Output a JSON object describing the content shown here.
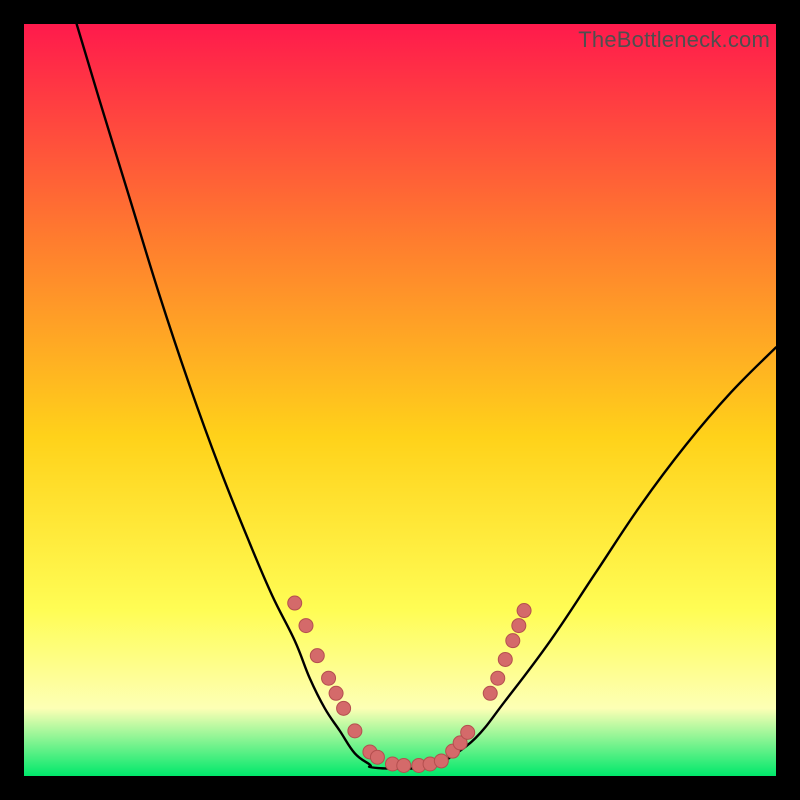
{
  "watermark": "TheBottleneck.com",
  "colors": {
    "gradient_top": "#ff1a4c",
    "gradient_mid_upper": "#ff7a2f",
    "gradient_mid": "#ffd21a",
    "gradient_mid_lower": "#fffd55",
    "gradient_pale": "#fdffb5",
    "gradient_bottom": "#00e86b",
    "curve": "#000000",
    "marker_fill": "#d46a6a",
    "marker_stroke": "#b44f4f"
  },
  "chart_data": {
    "type": "line",
    "title": "",
    "xlabel": "",
    "ylabel": "",
    "xlim": [
      0,
      100
    ],
    "ylim": [
      0,
      100
    ],
    "note": "Axes are implicit (no tick labels shown). x≈relative horizontal position (0–100), y≈bottleneck/mismatch percentage where 0 is bottom (green, good match) and 100 is top (red, severe bottleneck). Values are estimated from pixel positions.",
    "series": [
      {
        "name": "bottleneck-curve-left",
        "x": [
          7,
          10,
          14,
          18,
          22,
          26,
          30,
          33,
          36,
          38,
          40,
          42,
          44,
          46
        ],
        "values": [
          100,
          90,
          77,
          64,
          52,
          41,
          31,
          24,
          18,
          13,
          9,
          6,
          3,
          1.5
        ]
      },
      {
        "name": "bottleneck-curve-floor",
        "x": [
          46,
          48,
          50,
          52,
          54,
          56
        ],
        "values": [
          1.2,
          1.0,
          1.0,
          1.0,
          1.2,
          1.6
        ]
      },
      {
        "name": "bottleneck-curve-right",
        "x": [
          56,
          60,
          64,
          70,
          76,
          82,
          88,
          94,
          100
        ],
        "values": [
          2,
          5,
          10,
          18,
          27,
          36,
          44,
          51,
          57
        ]
      }
    ],
    "markers": {
      "name": "highlighted-points",
      "points": [
        {
          "x": 36,
          "y": 23
        },
        {
          "x": 37.5,
          "y": 20
        },
        {
          "x": 39,
          "y": 16
        },
        {
          "x": 40.5,
          "y": 13
        },
        {
          "x": 41.5,
          "y": 11
        },
        {
          "x": 42.5,
          "y": 9
        },
        {
          "x": 44,
          "y": 6
        },
        {
          "x": 46,
          "y": 3.2
        },
        {
          "x": 47,
          "y": 2.5
        },
        {
          "x": 49,
          "y": 1.6
        },
        {
          "x": 50.5,
          "y": 1.4
        },
        {
          "x": 52.5,
          "y": 1.4
        },
        {
          "x": 54,
          "y": 1.6
        },
        {
          "x": 55.5,
          "y": 2.0
        },
        {
          "x": 57,
          "y": 3.3
        },
        {
          "x": 58,
          "y": 4.4
        },
        {
          "x": 59,
          "y": 5.8
        },
        {
          "x": 62,
          "y": 11
        },
        {
          "x": 63,
          "y": 13
        },
        {
          "x": 64,
          "y": 15.5
        },
        {
          "x": 65,
          "y": 18
        },
        {
          "x": 65.8,
          "y": 20
        },
        {
          "x": 66.5,
          "y": 22
        }
      ]
    }
  }
}
